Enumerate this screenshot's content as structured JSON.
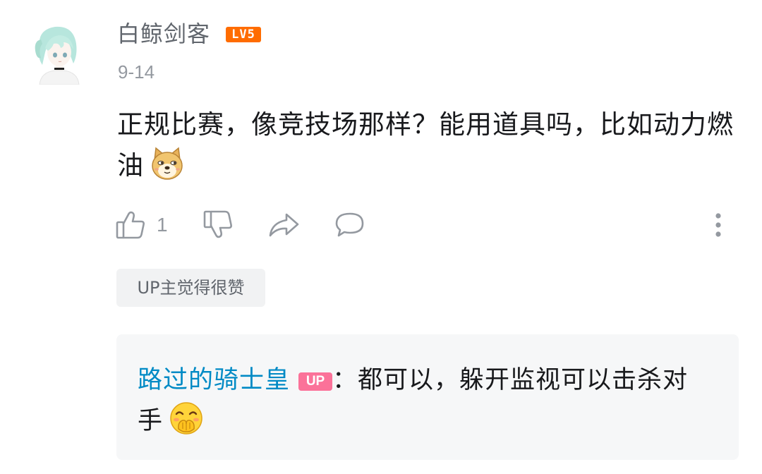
{
  "comment": {
    "username": "白鲸剑客",
    "level": "LV5",
    "date": "9-14",
    "text": "正规比赛，像竞技场那样？能用道具吗，比如动力燃油",
    "emoji": "doge-emoji",
    "like_count": "1",
    "up_liked_label": "UP主觉得很赞"
  },
  "reply": {
    "username": "路过的骑士皇",
    "badge": "UP",
    "separator": "：",
    "text": "都可以，躲开监视可以击杀对手",
    "emoji": "covering-mouth-laugh-emoji"
  },
  "icons": {
    "like": "thumbs-up-icon",
    "dislike": "thumbs-down-icon",
    "share": "share-icon",
    "reply": "speech-bubble-icon",
    "more": "more-vertical-icon"
  },
  "colors": {
    "level_badge": "#ff6c00",
    "up_badge": "#fb7299",
    "reply_username": "#008ac5",
    "muted_text": "#9499a0"
  }
}
